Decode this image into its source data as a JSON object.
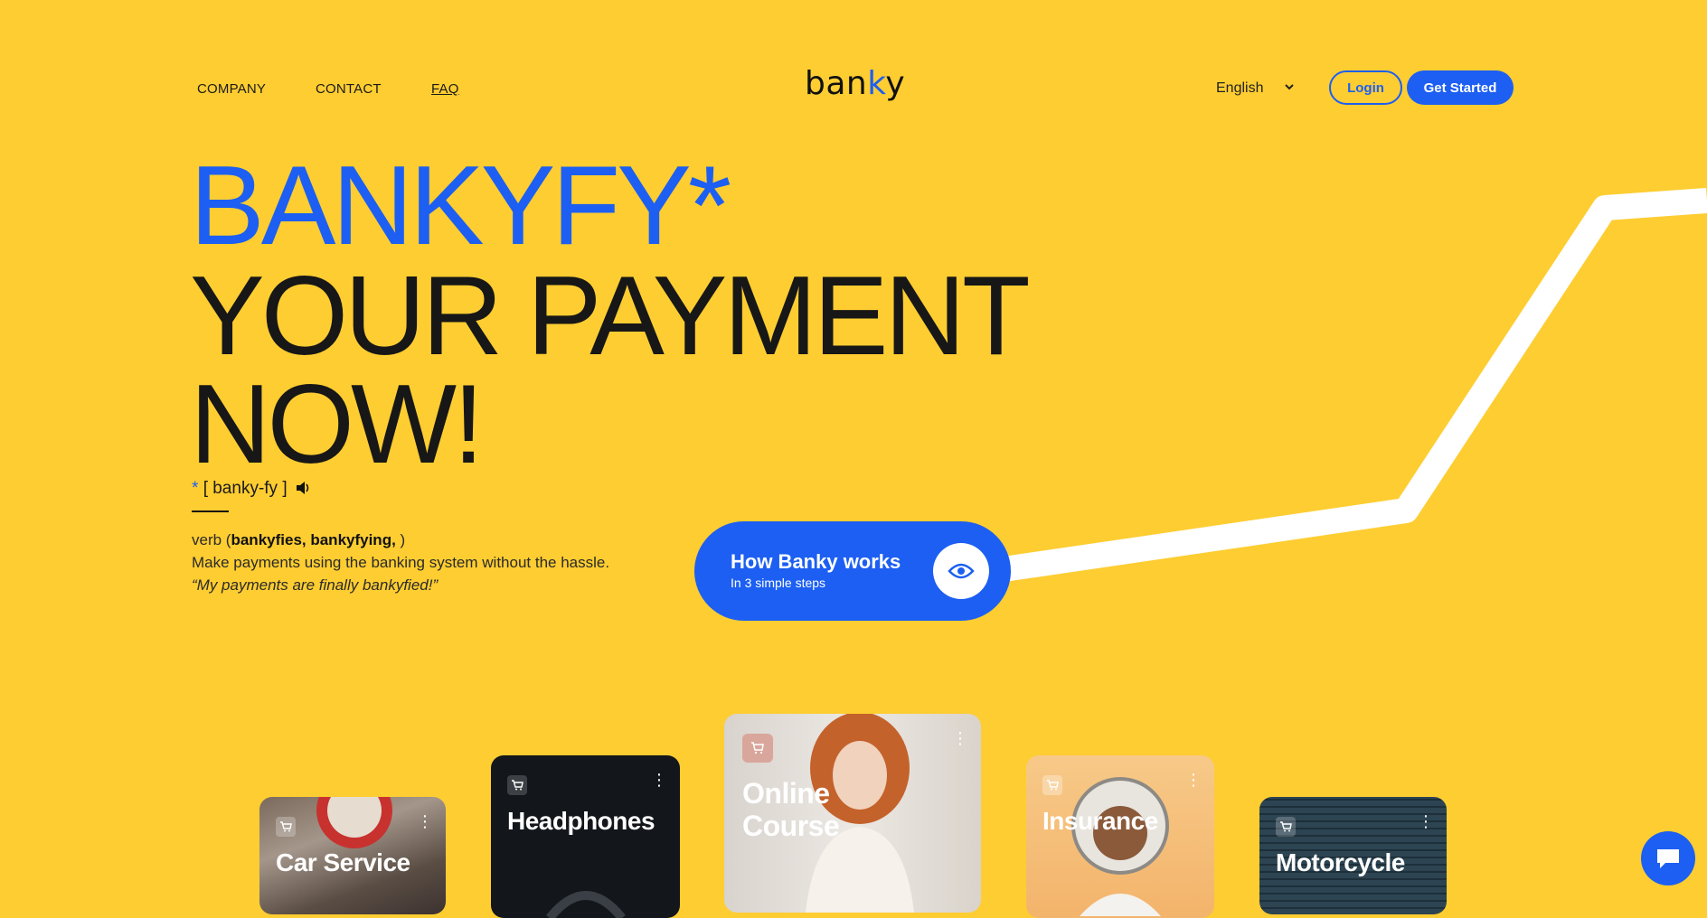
{
  "nav": {
    "links": [
      "COMPANY",
      "CONTACT",
      "FAQ"
    ],
    "logo_text": "ban",
    "logo_k": "k",
    "logo_y": "y",
    "language": "English",
    "login_label": "Login",
    "get_started_label": "Get Started"
  },
  "hero": {
    "line1": "BANKYFY*",
    "line2": "YOUR PAYMENT",
    "line3": "NOW!",
    "pron_star": "*",
    "pron": "[ banky-fy ]",
    "def_pre": "verb (",
    "def_forms": "bankyfies, bankyfying,",
    "def_post": " )",
    "def_text": "Make payments using the banking system without the hassle. ",
    "def_quote": "“My payments are finally bankyfied!”"
  },
  "cta": {
    "title": "How Banky works",
    "subtitle": "In 3 simple steps"
  },
  "cards": [
    {
      "title": "Car Service"
    },
    {
      "title": "Headphones"
    },
    {
      "title": "Online Course"
    },
    {
      "title": "Insurance"
    },
    {
      "title": "Motorcycle"
    }
  ],
  "colors": {
    "background": "#FECD31",
    "accent": "#1C5FF2",
    "text": "#171717"
  },
  "icons": [
    "speaker-icon",
    "eye-icon",
    "cart-icon",
    "more-vertical-icon",
    "chat-icon",
    "chevron-down-icon"
  ]
}
